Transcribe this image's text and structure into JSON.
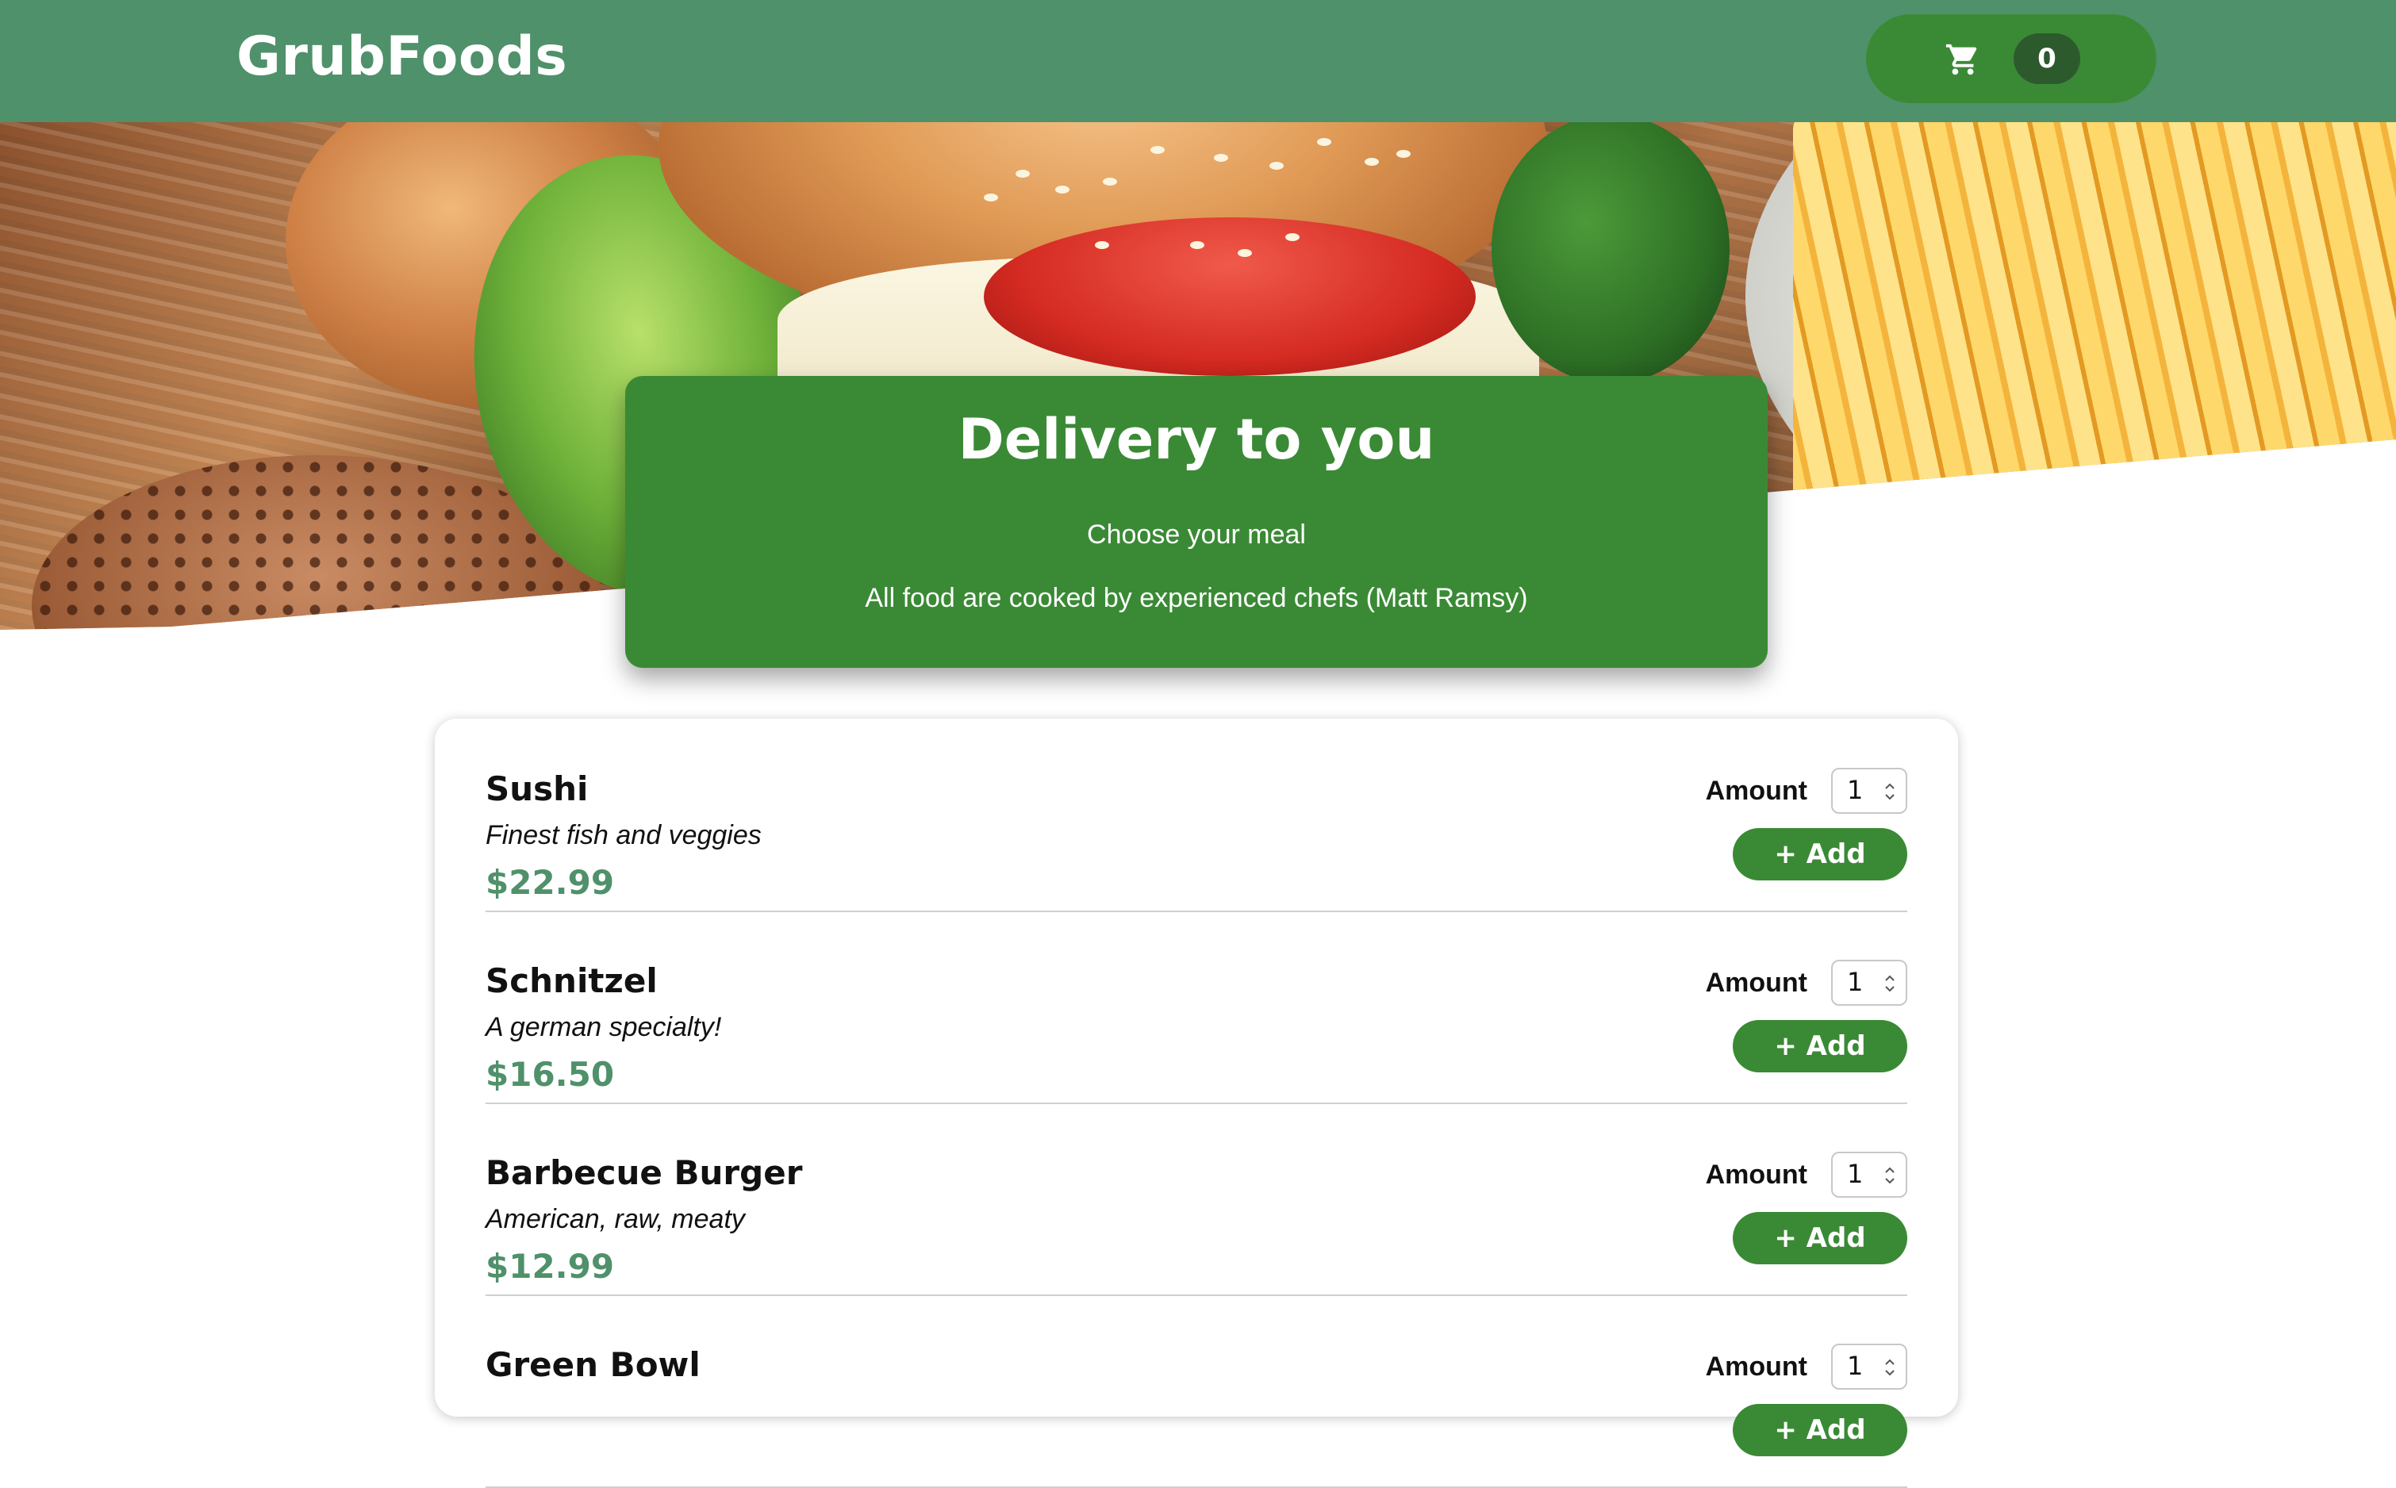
{
  "app": {
    "brand": "GrubFoods",
    "brand_color": "#4f916a",
    "accent_color": "#3a8a35"
  },
  "cart": {
    "icon": "cart-icon",
    "count": "0"
  },
  "hero": {
    "image": "food-photo",
    "title": "Delivery to you",
    "subtitle": "Choose your meal",
    "note": "All food are cooked by experienced chefs (Matt Ramsy)"
  },
  "meals": [
    {
      "name": "Sushi",
      "description": "Finest fish and veggies",
      "price": "$22.99",
      "amount_label": "Amount",
      "amount_value": "1",
      "add_label": "+ Add"
    },
    {
      "name": "Schnitzel",
      "description": "A german specialty!",
      "price": "$16.50",
      "amount_label": "Amount",
      "amount_value": "1",
      "add_label": "+ Add"
    },
    {
      "name": "Barbecue Burger",
      "description": "American, raw, meaty",
      "price": "$12.99",
      "amount_label": "Amount",
      "amount_value": "1",
      "add_label": "+ Add"
    },
    {
      "name": "Green Bowl",
      "description": "",
      "price": "",
      "amount_label": "Amount",
      "amount_value": "1",
      "add_label": "+ Add"
    }
  ]
}
